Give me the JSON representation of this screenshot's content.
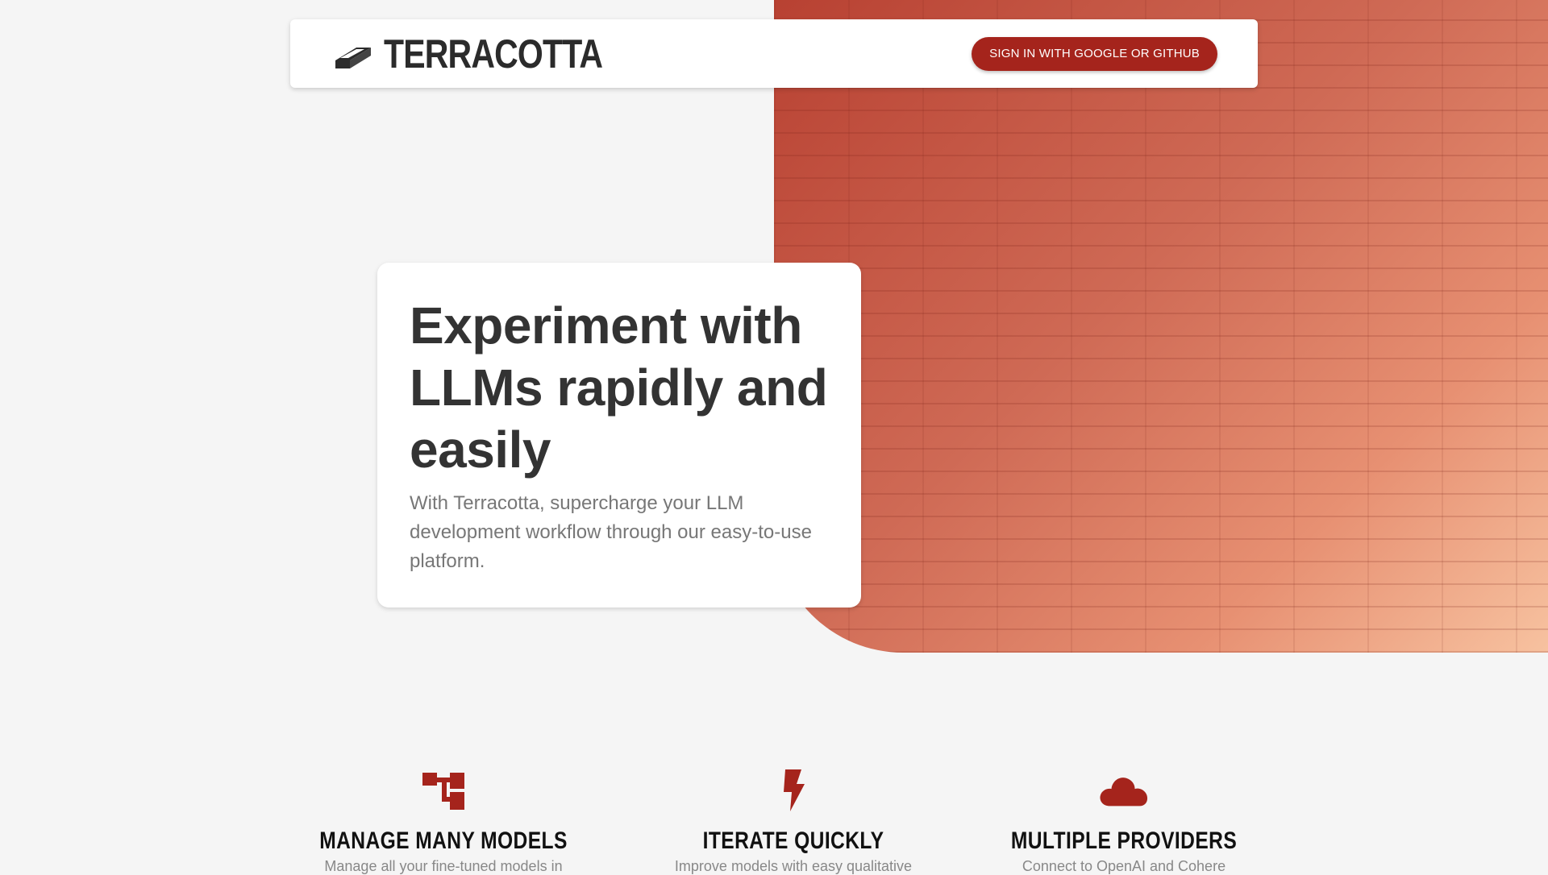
{
  "colors": {
    "accent": "#a5241c",
    "background": "#f5f5f5",
    "card": "#ffffff",
    "text_dark": "#333333",
    "text_muted": "#777777"
  },
  "navbar": {
    "logo_icon": "brick-icon",
    "brand": "TERRACOTTA",
    "signin_label": "SIGN IN WITH GOOGLE OR GITHUB"
  },
  "hero": {
    "title_lines": [
      "Experiment with",
      "LLMs rapidly and",
      "easily"
    ],
    "subtitle": "With Terracotta, supercharge your LLM development workflow through our easy-to-use platform."
  },
  "features": [
    {
      "icon": "hierarchy-icon",
      "title": "MANAGE MANY MODELS",
      "description": "Manage all your fine-tuned models in"
    },
    {
      "icon": "lightning-icon",
      "title": "ITERATE QUICKLY",
      "description": "Improve models with easy qualitative"
    },
    {
      "icon": "cloud-icon",
      "title": "MULTIPLE PROVIDERS",
      "description": "Connect to OpenAI and Cohere"
    }
  ]
}
